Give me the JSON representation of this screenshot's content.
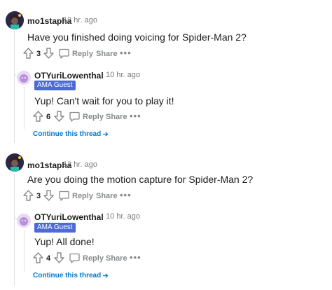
{
  "threads": [
    {
      "parent": {
        "username": "mo1stapha",
        "time": "12 hr. ago",
        "text": "Have you finished doing voicing for Spider-Man 2?",
        "votes": "3",
        "reply_label": "Reply",
        "share_label": "Share",
        "more_label": "•••"
      },
      "reply": {
        "username": "OTYuriLowenthal",
        "time": "10 hr. ago",
        "flair": "AMA Guest",
        "text": "Yup! Can't wait for you to play it!",
        "votes": "6",
        "reply_label": "Reply",
        "share_label": "Share",
        "more_label": "•••"
      },
      "continue_label": "Continue this thread"
    },
    {
      "parent": {
        "username": "mo1stapha",
        "time": "12 hr. ago",
        "text": "Are you doing the motion capture for Spider-Man 2?",
        "votes": "3",
        "reply_label": "Reply",
        "share_label": "Share",
        "more_label": "•••"
      },
      "reply": {
        "username": "OTYuriLowenthal",
        "time": "10 hr. ago",
        "flair": "AMA Guest",
        "text": "Yup! All done!",
        "votes": "4",
        "reply_label": "Reply",
        "share_label": "Share",
        "more_label": "•••"
      },
      "continue_label": "Continue this thread"
    }
  ],
  "separator": "·",
  "icons": {
    "upvote": "upvote-arrow-icon",
    "downvote": "downvote-arrow-icon",
    "reply": "speech-bubble-icon",
    "continue": "arrow-right-icon"
  },
  "colors": {
    "link": "#0079d3",
    "flair": "#4d6bd8",
    "meta": "#7c7c7c",
    "action": "#878a8c"
  }
}
